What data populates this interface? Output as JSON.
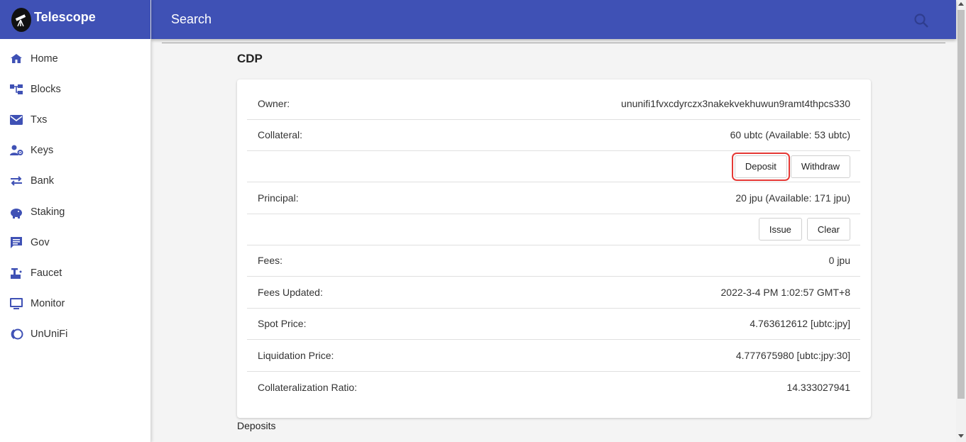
{
  "app": {
    "title": "Telescope"
  },
  "sidebar": {
    "items": [
      {
        "label": "Home",
        "icon": "home-icon"
      },
      {
        "label": "Blocks",
        "icon": "blocks-icon"
      },
      {
        "label": "Txs",
        "icon": "mail-icon"
      },
      {
        "label": "Keys",
        "icon": "key-icon"
      },
      {
        "label": "Bank",
        "icon": "swap-icon"
      },
      {
        "label": "Staking",
        "icon": "piggy-bank-icon"
      },
      {
        "label": "Gov",
        "icon": "chat-icon"
      },
      {
        "label": "Faucet",
        "icon": "faucet-icon"
      },
      {
        "label": "Monitor",
        "icon": "monitor-icon"
      },
      {
        "label": "UnUniFi",
        "icon": "ununifi-icon"
      }
    ]
  },
  "header": {
    "search_placeholder": "Search"
  },
  "page": {
    "title": "CDP",
    "deposits_label": "Deposits"
  },
  "cdp": {
    "owner_label": "Owner:",
    "owner_value": "ununifi1fvxcdyrczx3nakekvekhuwun9ramt4thpcs330",
    "collateral_label": "Collateral:",
    "collateral_value": "60 ubtc (Available: 53 ubtc)",
    "deposit_label": "Deposit",
    "withdraw_label": "Withdraw",
    "principal_label": "Principal:",
    "principal_value": "20 jpu (Available: 171 jpu)",
    "issue_label": "Issue",
    "clear_label": "Clear",
    "fees_label": "Fees:",
    "fees_value": "0 jpu",
    "fees_updated_label": "Fees Updated:",
    "fees_updated_value": "2022-3-4 PM 1:02:57 GMT+8",
    "spot_price_label": "Spot Price:",
    "spot_price_value": "4.763612612 [ubtc:jpy]",
    "liquidation_price_label": "Liquidation Price:",
    "liquidation_price_value": "4.777675980 [ubtc:jpy:30]",
    "collateralization_ratio_label": "Collateralization Ratio:",
    "collateralization_ratio_value": "14.333027941"
  },
  "colors": {
    "primary": "#3f51b5",
    "highlight": "#e53935"
  }
}
